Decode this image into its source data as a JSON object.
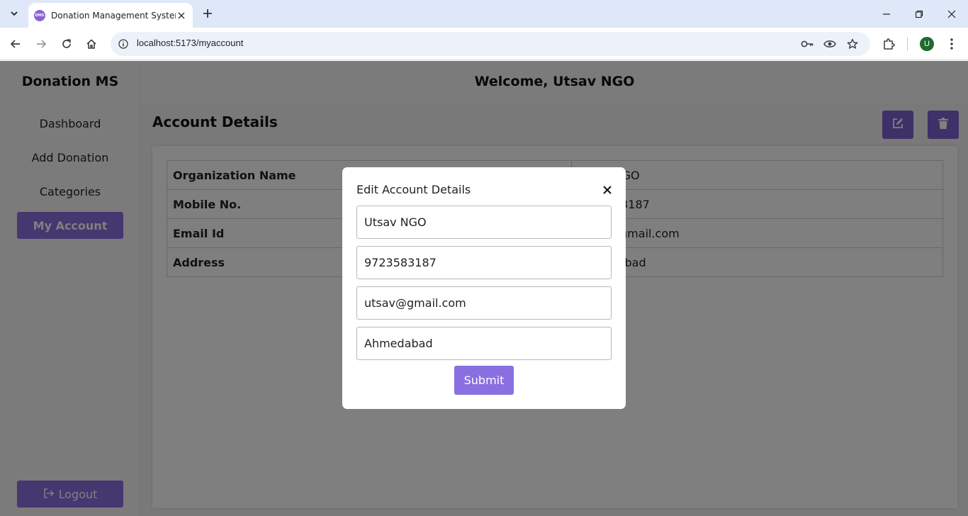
{
  "browser": {
    "tab_title": "Donation Management System",
    "favicon_text": "DMS",
    "url": "localhost:5173/myaccount",
    "profile_initial": "U"
  },
  "sidebar": {
    "brand": "Donation MS",
    "items": [
      {
        "label": "Dashboard",
        "active": false
      },
      {
        "label": "Add Donation",
        "active": false
      },
      {
        "label": "Categories",
        "active": false
      },
      {
        "label": "My Account",
        "active": true
      }
    ],
    "logout_label": "Logout"
  },
  "header": {
    "welcome": "Welcome, Utsav NGO"
  },
  "main": {
    "title": "Account Details",
    "rows": [
      {
        "label": "Organization Name",
        "value": "Utsav NGO"
      },
      {
        "label": "Mobile No.",
        "value": "9723583187"
      },
      {
        "label": "Email Id",
        "value": "utsav@gmail.com"
      },
      {
        "label": "Address",
        "value": "Ahmedabad"
      }
    ]
  },
  "modal": {
    "title": "Edit Account Details",
    "fields": {
      "name": "Utsav NGO",
      "mobile": "9723583187",
      "email": "utsav@gmail.com",
      "address": "Ahmedabad"
    },
    "submit_label": "Submit"
  },
  "colors": {
    "accent": "#8a6fe0",
    "accent_dark": "#7a62d0"
  }
}
